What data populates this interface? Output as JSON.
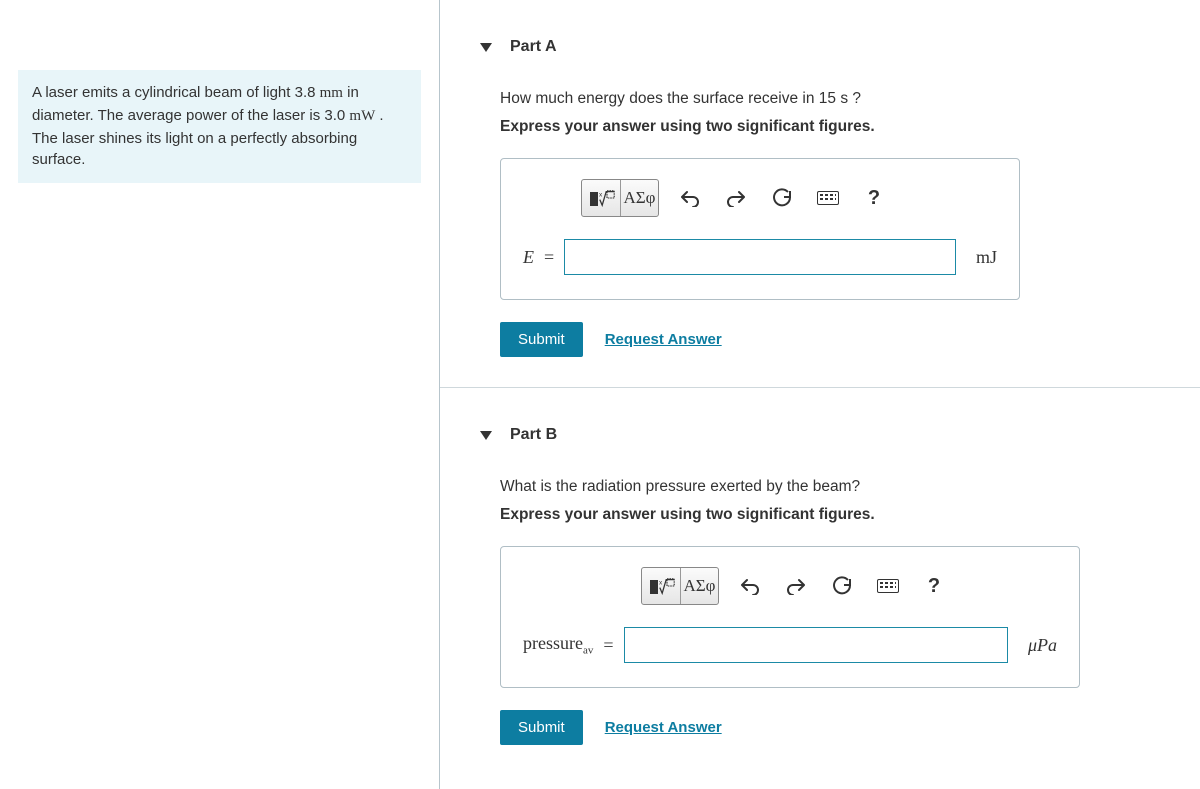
{
  "problem": {
    "text_1": "A laser emits a cylindrical beam of light 3.8 ",
    "unit_1": "mm",
    "text_2": " in diameter. The average power of the laser is 3.0 ",
    "unit_2": "mW",
    "text_3": " . The laser shines its light on a perfectly absorbing surface."
  },
  "partA": {
    "title": "Part A",
    "question": "How much energy does the surface receive in 15 s ?",
    "instruction": "Express your answer using two significant figures.",
    "toolbar": {
      "greek": "ΑΣφ",
      "help": "?"
    },
    "var": "E",
    "eq": "=",
    "value": "",
    "unit": "mJ",
    "submit": "Submit",
    "request": "Request Answer"
  },
  "partB": {
    "title": "Part B",
    "question": "What is the radiation pressure exerted by the beam?",
    "instruction": "Express your answer using two significant figures.",
    "toolbar": {
      "greek": "ΑΣφ",
      "help": "?"
    },
    "var": "pressure",
    "sub": "av",
    "eq": "=",
    "value": "",
    "unit": "μPa",
    "submit": "Submit",
    "request": "Request Answer"
  }
}
